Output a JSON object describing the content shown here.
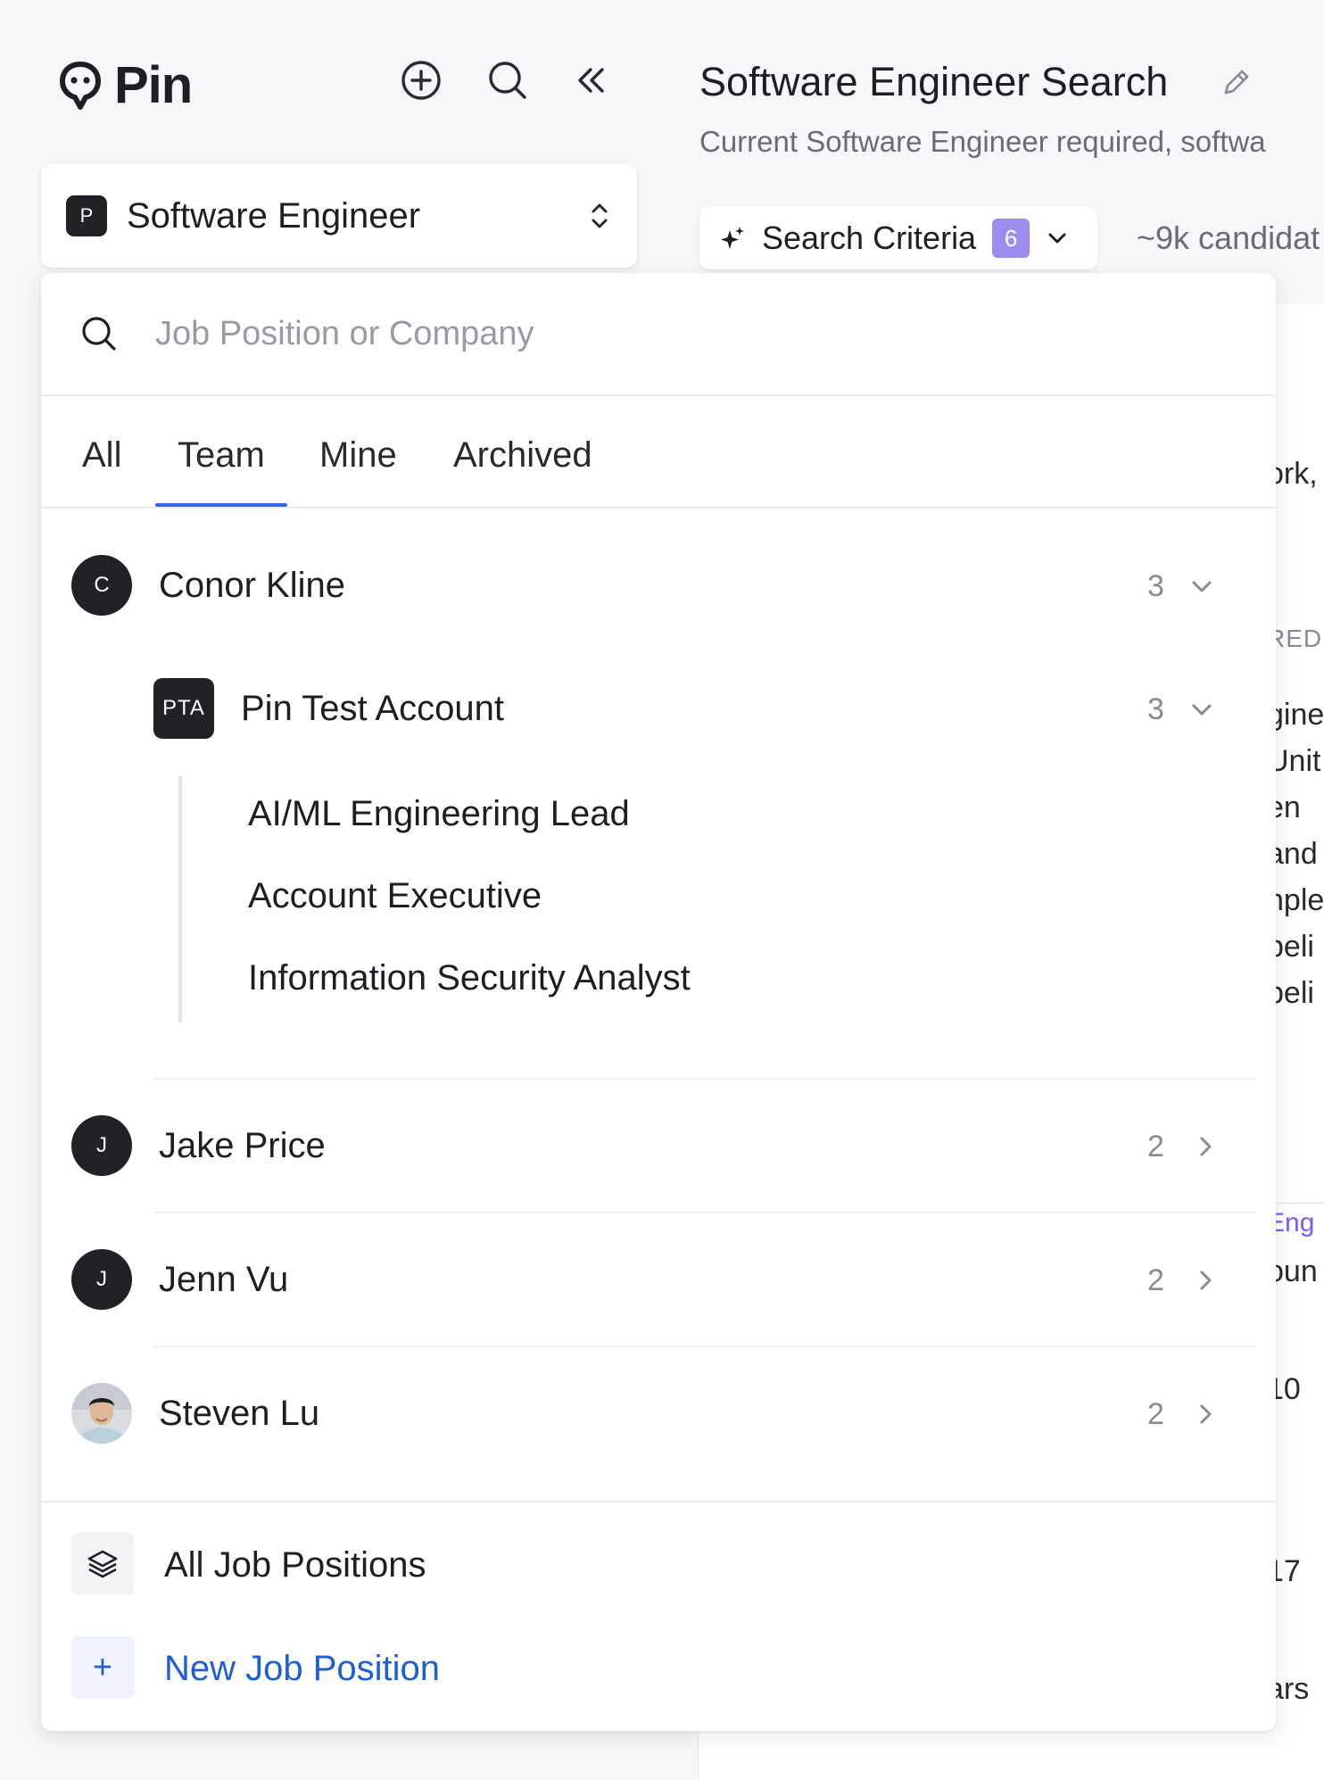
{
  "app": {
    "name": "Pin"
  },
  "workspace": {
    "badge": "P",
    "title": "Software Engineer"
  },
  "page": {
    "title": "Software Engineer Search",
    "subtitle": "Current Software Engineer required, softwa",
    "criteria_label": "Search Criteria",
    "criteria_count": "6",
    "candidates": "~9k candidat"
  },
  "background_fragments": [
    "ork,",
    "RED",
    "gine",
    "Unit",
    "en",
    "and",
    "nple",
    "peli",
    "peli",
    "Eng",
    "oun",
    "10",
    "17",
    "ars"
  ],
  "search": {
    "placeholder": "Job Position or Company",
    "value": ""
  },
  "tabs": [
    {
      "label": "All"
    },
    {
      "label": "Team",
      "active": true
    },
    {
      "label": "Mine"
    },
    {
      "label": "Archived"
    }
  ],
  "people": [
    {
      "initial": "C",
      "name": "Conor Kline",
      "count": "3",
      "expanded": true,
      "accounts": [
        {
          "badge": "PTA",
          "name": "Pin Test Account",
          "count": "3",
          "expanded": true,
          "jobs": [
            "AI/ML Engineering Lead",
            "Account Executive",
            "Information Security Analyst"
          ]
        }
      ]
    },
    {
      "initial": "J",
      "name": "Jake Price",
      "count": "2",
      "expanded": false
    },
    {
      "initial": "J",
      "name": "Jenn Vu",
      "count": "2",
      "expanded": false
    },
    {
      "initial": "",
      "name": "Steven Lu",
      "count": "2",
      "expanded": false,
      "photo": true
    }
  ],
  "footer": {
    "all_positions": "All Job Positions",
    "new_position": "New Job Position",
    "new_icon": "+"
  },
  "colors": {
    "accent_blue": "#2b6fe6",
    "link_blue": "#1f5fd6",
    "criteria_badge": "#9b8cf0",
    "avatar_dark": "#222226"
  },
  "icons": {
    "logo": "speech-bubble-face-icon",
    "add": "plus-circle-icon",
    "search": "search-icon",
    "collapse": "double-chevron-left-icon",
    "selector": "chevron-up-down-icon",
    "edit": "pencil-icon",
    "sparkle": "sparkle-icon",
    "layers": "layers-icon"
  }
}
